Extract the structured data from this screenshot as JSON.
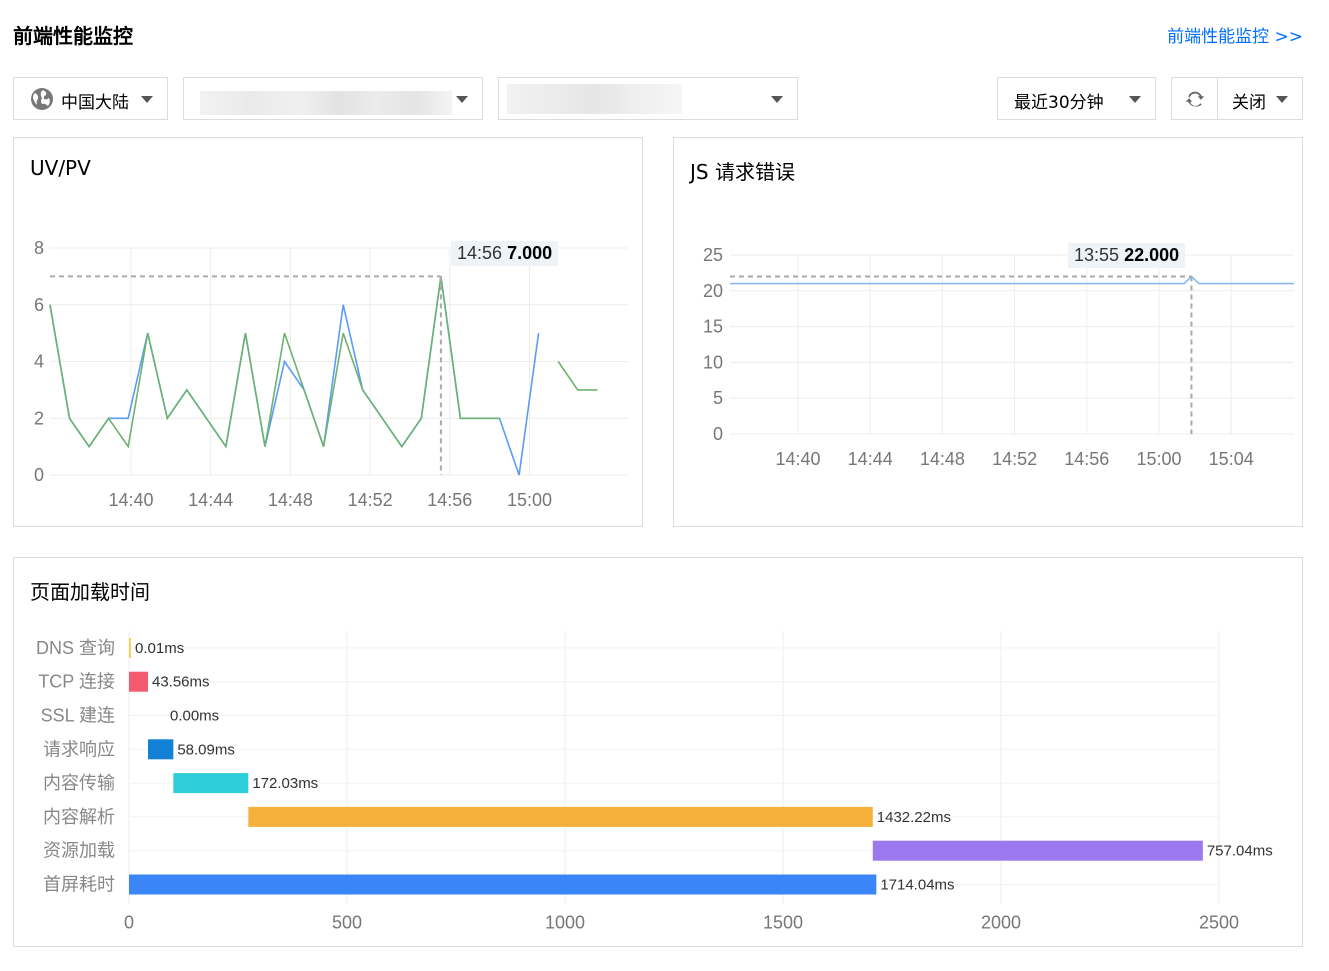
{
  "page": {
    "title": "前端性能监控",
    "link": "前端性能监控 >>"
  },
  "filters": {
    "region": "中国大陆",
    "time_range": "最近30分钟",
    "refresh": "关闭"
  },
  "uvpv": {
    "title": "UV/PV",
    "tooltip_time": "14:56",
    "tooltip_value": "7.000",
    "chart_data": {
      "type": "line",
      "x_ticks": [
        "14:40",
        "14:44",
        "14:48",
        "14:52",
        "14:56",
        "15:00"
      ],
      "ylim": [
        0,
        8
      ],
      "y_ticks": [
        0,
        2,
        4,
        6,
        8
      ],
      "series": [
        {
          "color": "#5b9cf5",
          "values": [
            6,
            2,
            1,
            2,
            2,
            5,
            2,
            3,
            2,
            1,
            5,
            1,
            4,
            3,
            1,
            6,
            3,
            2,
            1,
            2,
            7,
            2,
            2,
            2,
            0,
            5,
            null,
            null
          ]
        },
        {
          "color": "#6cb36f",
          "values": [
            6,
            2,
            1,
            2,
            1,
            5,
            2,
            3,
            2,
            1,
            5,
            1,
            5,
            3,
            1,
            5,
            3,
            2,
            1,
            2,
            7,
            2,
            2,
            2,
            null,
            null,
            4,
            3,
            3
          ]
        }
      ],
      "marker_index": 20
    }
  },
  "jserr": {
    "title": "JS 请求错误",
    "tooltip_time": "13:55",
    "tooltip_value": "22.000",
    "chart_data": {
      "type": "line",
      "x_ticks": [
        "14:40",
        "14:44",
        "14:48",
        "14:52",
        "14:56",
        "15:00",
        "15:04"
      ],
      "ylim": [
        0,
        25
      ],
      "y_ticks": [
        0,
        5,
        10,
        15,
        20,
        25
      ],
      "series": [
        {
          "color": "#8ab8f5",
          "values": [
            21,
            21,
            21,
            21,
            21,
            21,
            21,
            21,
            21,
            21,
            21,
            21,
            21,
            21,
            21,
            21,
            21,
            21,
            21,
            21,
            21,
            21,
            21,
            21,
            21,
            21,
            21,
            21,
            21,
            21,
            21,
            21,
            21,
            21,
            21,
            21,
            21,
            21,
            21,
            21,
            21,
            21,
            21,
            21,
            21,
            21,
            21,
            21,
            21,
            21,
            21,
            21,
            21,
            21,
            21,
            21,
            21,
            21,
            21,
            21,
            21,
            21,
            21,
            22,
            21,
            21,
            21,
            21,
            21,
            21,
            21,
            21,
            21,
            21,
            21,
            21,
            21,
            21
          ]
        }
      ],
      "marker_index": 63
    }
  },
  "load": {
    "title": "页面加载时间",
    "chart_data": {
      "type": "bar",
      "orientation": "horizontal-waterfall",
      "xlim": [
        0,
        2500
      ],
      "x_ticks": [
        0,
        500,
        1000,
        1500,
        2000,
        2500
      ],
      "bars": [
        {
          "label": "DNS 查询",
          "start": 0,
          "value": 0.01,
          "text": "0.01ms",
          "color": "#f7d35d"
        },
        {
          "label": "TCP 连接",
          "start": 0,
          "value": 43.56,
          "text": "43.56ms",
          "color": "#f25c6e"
        },
        {
          "label": "SSL 建连",
          "start": 43.56,
          "value": 0,
          "text": "0.00ms",
          "color": "#999999"
        },
        {
          "label": "请求响应",
          "start": 43.56,
          "value": 58.09,
          "text": "58.09ms",
          "color": "#1180d5"
        },
        {
          "label": "内容传输",
          "start": 101.65,
          "value": 172.03,
          "text": "172.03ms",
          "color": "#2ccfd9"
        },
        {
          "label": "内容解析",
          "start": 273.68,
          "value": 1432.22,
          "text": "1432.22ms",
          "color": "#f6b03c"
        },
        {
          "label": "资源加载",
          "start": 1705.9,
          "value": 757.04,
          "text": "757.04ms",
          "color": "#9b78ee"
        },
        {
          "label": "首屏耗时",
          "start": 0,
          "value": 1714.04,
          "text": "1714.04ms",
          "color": "#3a86f8"
        }
      ]
    }
  }
}
